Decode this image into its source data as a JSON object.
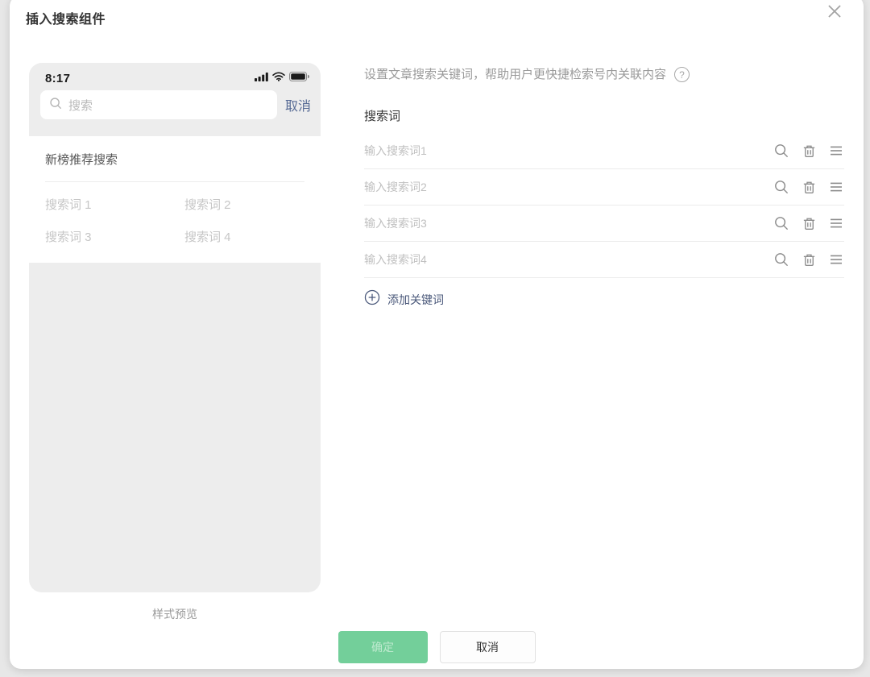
{
  "dialog": {
    "title": "插入搜索组件"
  },
  "icons": {
    "help": "?"
  },
  "preview": {
    "time": "8:17",
    "search_placeholder": "搜索",
    "cancel_label": "取消",
    "recommend_title": "新榜推荐搜索",
    "terms": [
      "搜索词 1",
      "搜索词 2",
      "搜索词 3",
      "搜索词 4"
    ],
    "caption": "样式预览"
  },
  "settings": {
    "description": "设置文章搜索关键词，帮助用户更快捷检索号内关联内容",
    "section_title": "搜索词",
    "keywords": [
      {
        "placeholder": "输入搜索词1"
      },
      {
        "placeholder": "输入搜索词2"
      },
      {
        "placeholder": "输入搜索词3"
      },
      {
        "placeholder": "输入搜索词4"
      }
    ],
    "add_label": "添加关键词"
  },
  "footer": {
    "confirm_label": "确定",
    "cancel_label": "取消"
  },
  "colors": {
    "accent_green": "#73cf9a",
    "preview_link_blue": "#576b95",
    "add_link_color": "#4a587a",
    "icon_gray": "#8c8c8c"
  }
}
